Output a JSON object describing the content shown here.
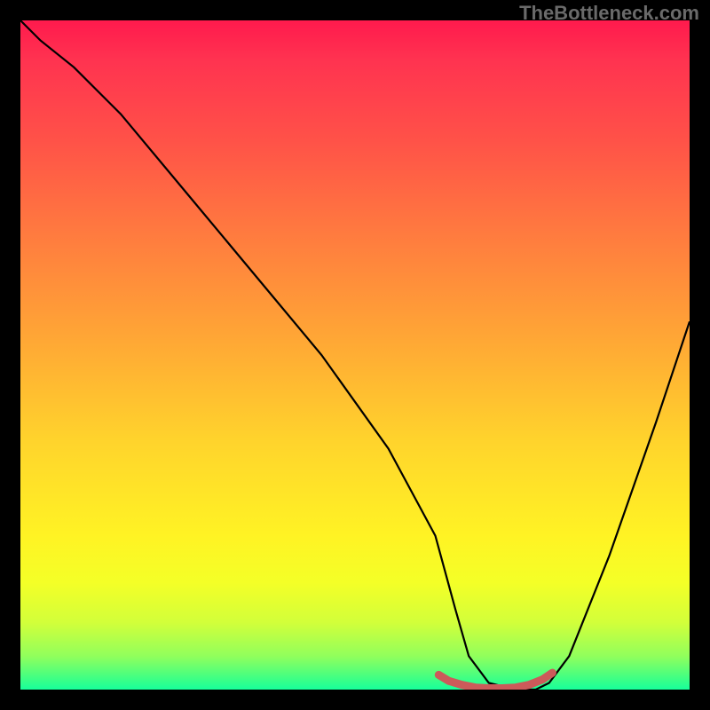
{
  "watermark": "TheBottleneck.com",
  "chart_data": {
    "type": "line",
    "title": "",
    "xlabel": "",
    "ylabel": "",
    "xlim": [
      0,
      100
    ],
    "ylim": [
      0,
      100
    ],
    "series": [
      {
        "name": "bottleneck-curve",
        "x_pct": [
          0,
          3,
          8,
          15,
          25,
          35,
          45,
          55,
          62,
          65,
          67,
          70,
          74,
          77,
          79,
          82,
          88,
          95,
          100
        ],
        "y_pct": [
          100,
          97,
          93,
          86,
          74,
          62,
          50,
          36,
          23,
          12,
          5,
          1,
          0,
          0,
          1,
          5,
          20,
          40,
          55
        ],
        "color": "#000000"
      },
      {
        "name": "optimal-range",
        "x_pct": [
          62.5,
          64,
          66,
          68,
          70,
          72,
          74,
          76,
          78,
          79.5
        ],
        "y_pct": [
          2.2,
          1.3,
          0.7,
          0.3,
          0.2,
          0.2,
          0.3,
          0.7,
          1.5,
          2.5
        ],
        "color": "#cc5a5a",
        "stroke_width": 9
      }
    ],
    "gradient_stops": [
      {
        "pct": 0,
        "color": "#ff1a4d"
      },
      {
        "pct": 50,
        "color": "#ffb030"
      },
      {
        "pct": 80,
        "color": "#fff525"
      },
      {
        "pct": 100,
        "color": "#17ff9b"
      }
    ]
  }
}
